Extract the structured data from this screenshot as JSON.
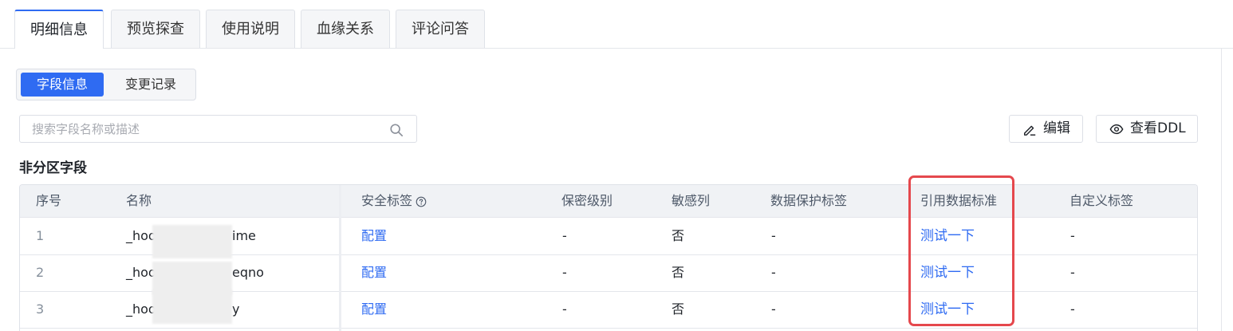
{
  "tabs": [
    "明细信息",
    "预览探查",
    "使用说明",
    "血缘关系",
    "评论问答"
  ],
  "segment": {
    "active": "字段信息",
    "other": "变更记录"
  },
  "search": {
    "placeholder": "搜索字段名称或描述"
  },
  "buttons": {
    "edit": "编辑",
    "view_ddl": "查看DDL"
  },
  "section_title": "非分区字段",
  "table": {
    "headers": [
      "序号",
      "名称",
      "安全标签",
      "保密级别",
      "敏感列",
      "数据保护标签",
      "引用数据标准",
      "自定义标签"
    ],
    "rows": [
      {
        "index": "1",
        "name": "_hoo",
        "name_suffix": "ime",
        "security": "配置",
        "secret": "-",
        "sensitive": "否",
        "protect": "-",
        "standard": "测试一下",
        "custom": "-"
      },
      {
        "index": "2",
        "name": "_hoo",
        "name_suffix": "eqno",
        "security": "配置",
        "secret": "-",
        "sensitive": "否",
        "protect": "-",
        "standard": "测试一下",
        "custom": "-"
      },
      {
        "index": "3",
        "name": "_hoo",
        "name_suffix": "y",
        "security": "配置",
        "secret": "-",
        "sensitive": "否",
        "protect": "-",
        "standard": "测试一下",
        "custom": "-"
      }
    ]
  },
  "colors": {
    "accent": "#2f6bf2",
    "highlight": "#e5484d"
  }
}
